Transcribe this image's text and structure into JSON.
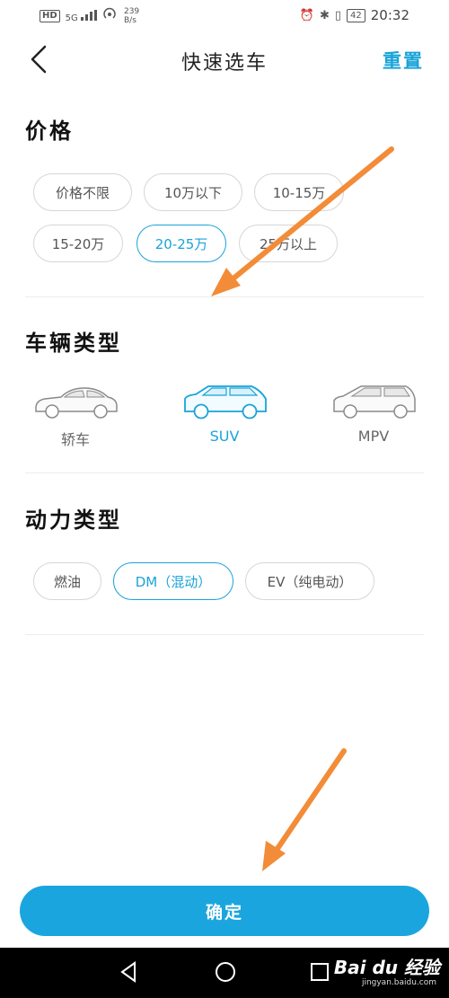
{
  "status_bar": {
    "hd": "HD",
    "signal": "5G",
    "speed_value": "239",
    "speed_unit": "B/s",
    "battery": "42",
    "time": "20:32"
  },
  "header": {
    "title": "快速选车",
    "reset_label": "重置"
  },
  "price": {
    "title": "价格",
    "options": [
      "价格不限",
      "10万以下",
      "10-15万",
      "15-20万",
      "20-25万",
      "25万以上"
    ],
    "selected": "20-25万"
  },
  "vehicle_type": {
    "title": "车辆类型",
    "options": [
      "轿车",
      "SUV",
      "MPV"
    ],
    "selected": "SUV"
  },
  "power_type": {
    "title": "动力类型",
    "options": [
      "燃油",
      "DM（混动）",
      "EV（纯电动）"
    ],
    "selected": "DM（混动）"
  },
  "confirm_label": "确定",
  "watermark": {
    "text": "Bai du 经验",
    "url": "jingyan.baidu.com"
  },
  "colors": {
    "accent": "#1aa3d9",
    "button": "#1ba5de",
    "arrow": "#f28c38"
  }
}
